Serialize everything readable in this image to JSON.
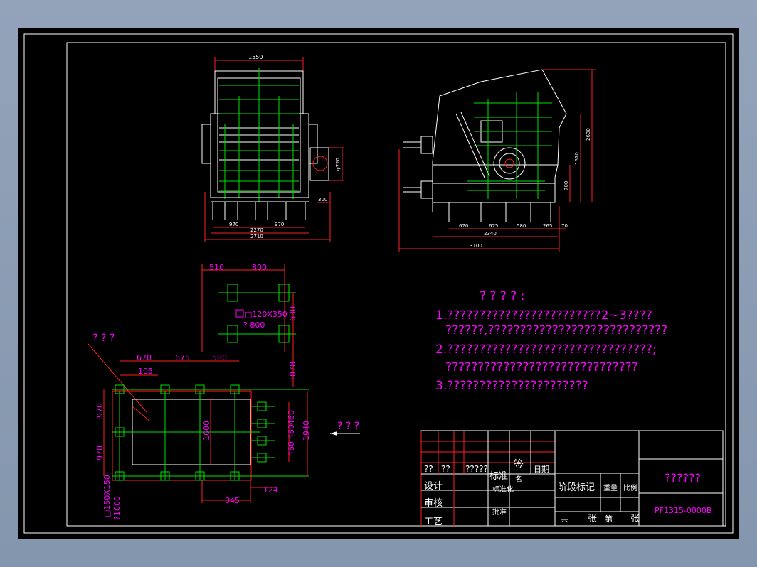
{
  "drawing": {
    "colors": {
      "background": "#000000",
      "frame": "#ffffff",
      "dimension": "#ff2020",
      "annotation": "#ff00ff",
      "centerline": "#00e000"
    },
    "front_view": {
      "top_dim": "1550",
      "bottom_dims": [
        "970",
        "2270",
        "970",
        "2710"
      ],
      "side_dims": [
        "φ720",
        "300"
      ]
    },
    "side_view": {
      "height_dims": [
        "2630",
        "1670",
        "700"
      ],
      "bottom_dims": [
        "670",
        "675",
        "580",
        "265",
        "70",
        "2340",
        "3100"
      ]
    },
    "foundation": {
      "label": "? ? ?",
      "top_dims": [
        "510",
        "800"
      ],
      "slot_label": "□120X350",
      "slot_depth": "? 800",
      "vertical_dims": [
        "630",
        "1078"
      ],
      "plan_dims": [
        "670",
        "675",
        "580",
        "105"
      ],
      "left_dims": [
        "970",
        "970"
      ],
      "inner_dim": "1600",
      "right_dims": [
        "460",
        "460",
        "460",
        "1940"
      ],
      "bottom_dims": [
        "845",
        "124"
      ],
      "corner_label": "□150X150",
      "corner_depth": "?1000"
    },
    "arrow_label": "? ? ?",
    "notes": {
      "title": "?  ?  ?  ?  :",
      "lines": [
        "1.????????????????????????2~3????",
        "??????,????????????????????????????",
        "2.????????????????????????????????;",
        "??????????????????????????????",
        "3.??????????????????????"
      ]
    },
    "title_block": {
      "row_a": [
        "??",
        "??",
        "?????",
        "标准",
        "签",
        "名",
        "日期"
      ],
      "side_labels": [
        "设计",
        "审核",
        "工艺"
      ],
      "std_label": "标准化",
      "approve_label": "批准",
      "stage_label": "阶段标记",
      "weight_label": "重量",
      "scale_label": "比例",
      "sheet_total": "共",
      "sheet_unit": "张",
      "sheet_no": "第",
      "sheet_unit2": "张",
      "drawing_name": "??????",
      "drawing_code": "PF1315-0000B"
    }
  }
}
